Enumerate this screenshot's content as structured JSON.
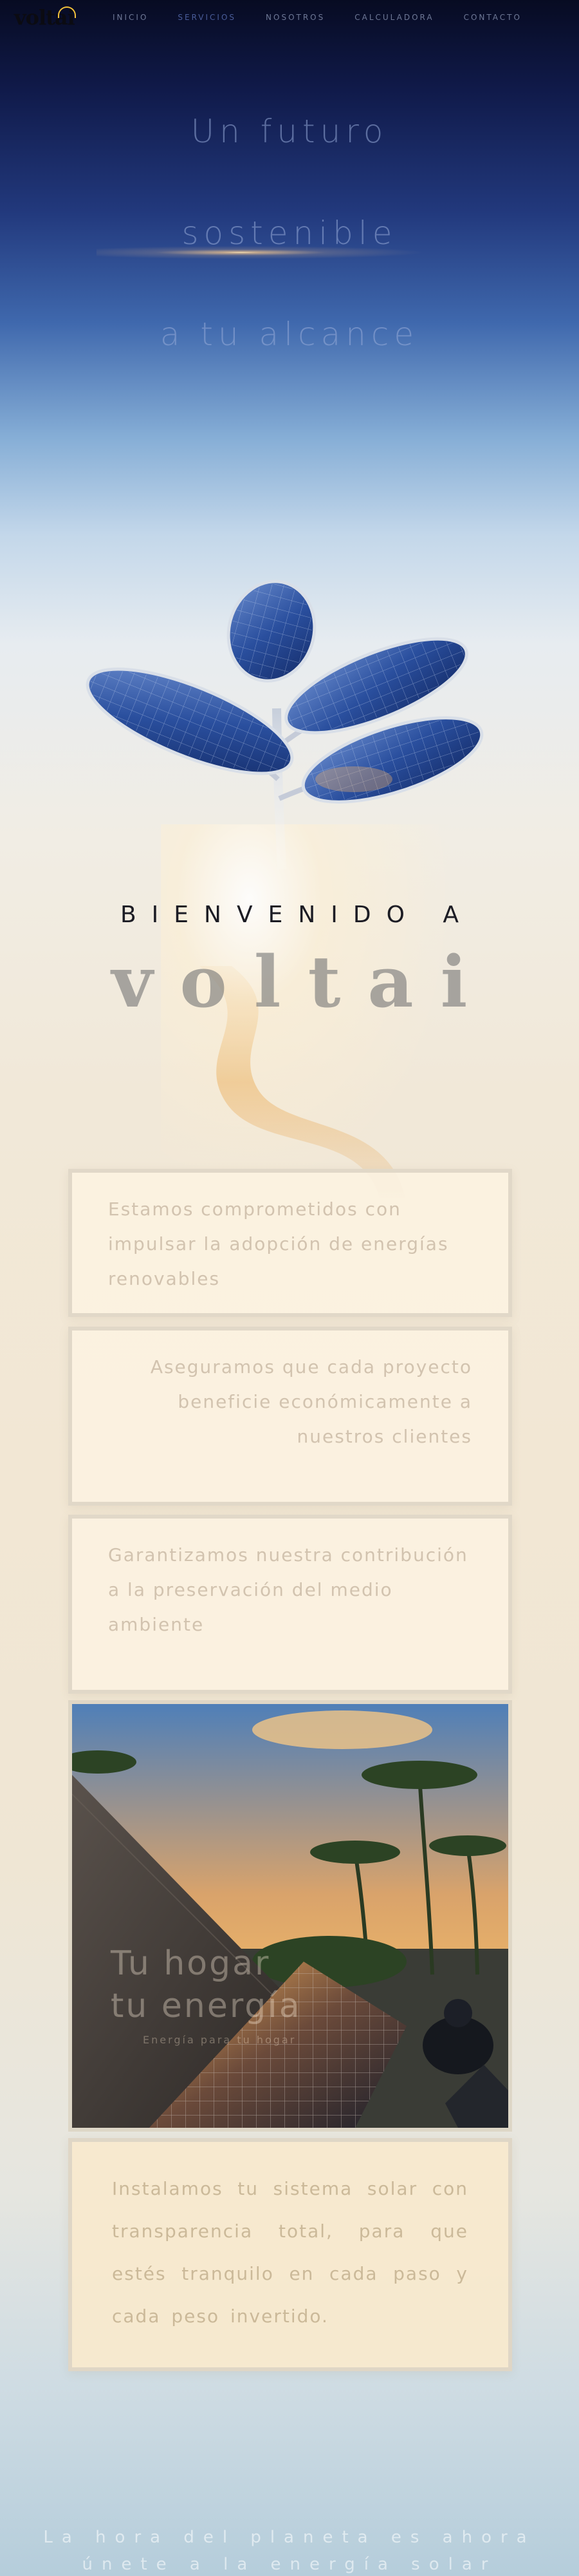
{
  "brand": {
    "logo_text": "voltai"
  },
  "nav": {
    "items": [
      {
        "label": "INICIO"
      },
      {
        "label": "SERVICIOS"
      },
      {
        "label": "NOSOTROS"
      },
      {
        "label": "CALCULADORA"
      },
      {
        "label": "CONTACTO"
      }
    ]
  },
  "hero": {
    "line1": "Un futuro",
    "line2": "sostenible",
    "line3": "a tu alcance"
  },
  "welcome": {
    "heading": "BIENVENIDO A",
    "brand_name": "voltai"
  },
  "cards": [
    {
      "text": "Estamos comprometidos con impulsar la adopción de energías renovables"
    },
    {
      "text": "Aseguramos que cada proyecto beneficie económicamente a nuestros clientes"
    },
    {
      "text": "Garantizamos nuestra contribución a la preservación del medio ambiente"
    }
  ],
  "photo": {
    "title_line1": "Tu hogar",
    "title_line2": "tu energía",
    "subtitle": "Energía para tu hogar"
  },
  "promise": {
    "text": "Instalamos tu sistema solar con transparencia total, para que estés tranquilo en cada paso y cada peso invertido."
  },
  "footer": {
    "line1": "La hora del planeta es ahora",
    "line2": "únete a la energía solar"
  },
  "colors": {
    "accent_gold": "#f3c23a",
    "nav_text": "#6e7896",
    "card_bg": "#fcf2e1"
  }
}
